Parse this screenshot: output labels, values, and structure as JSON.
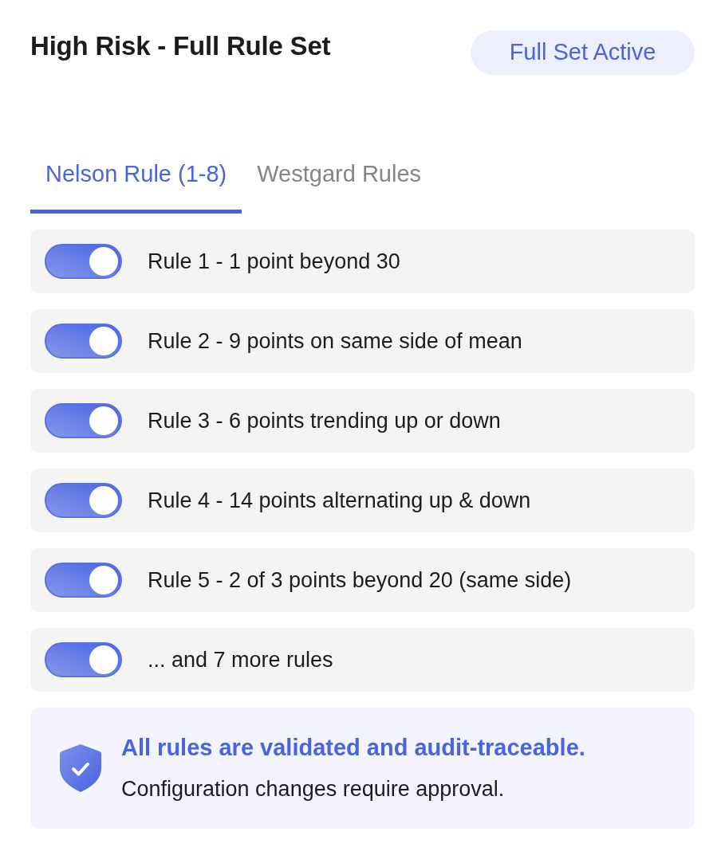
{
  "header": {
    "title": "High Risk - Full Rule Set",
    "badge": "Full Set Active"
  },
  "tabs": [
    {
      "label": "Nelson Rule (1-8)",
      "selected": true
    },
    {
      "label": "Westgard Rules",
      "selected": false
    }
  ],
  "rules": [
    {
      "label": "Rule 1 - 1 point beyond 30",
      "on": true
    },
    {
      "label": "Rule 2 - 9 points on same side of mean",
      "on": true
    },
    {
      "label": "Rule 3 - 6 points trending up or down",
      "on": true
    },
    {
      "label": "Rule 4 - 14 points alternating up & down",
      "on": true
    },
    {
      "label": "Rule 5 - 2 of 3 points beyond 20 (same side)",
      "on": true
    },
    {
      "label": "... and 7 more rules",
      "on": true
    }
  ],
  "notice": {
    "title": "All rules are validated and audit-traceable.",
    "text": "Configuration changes require approval."
  }
}
